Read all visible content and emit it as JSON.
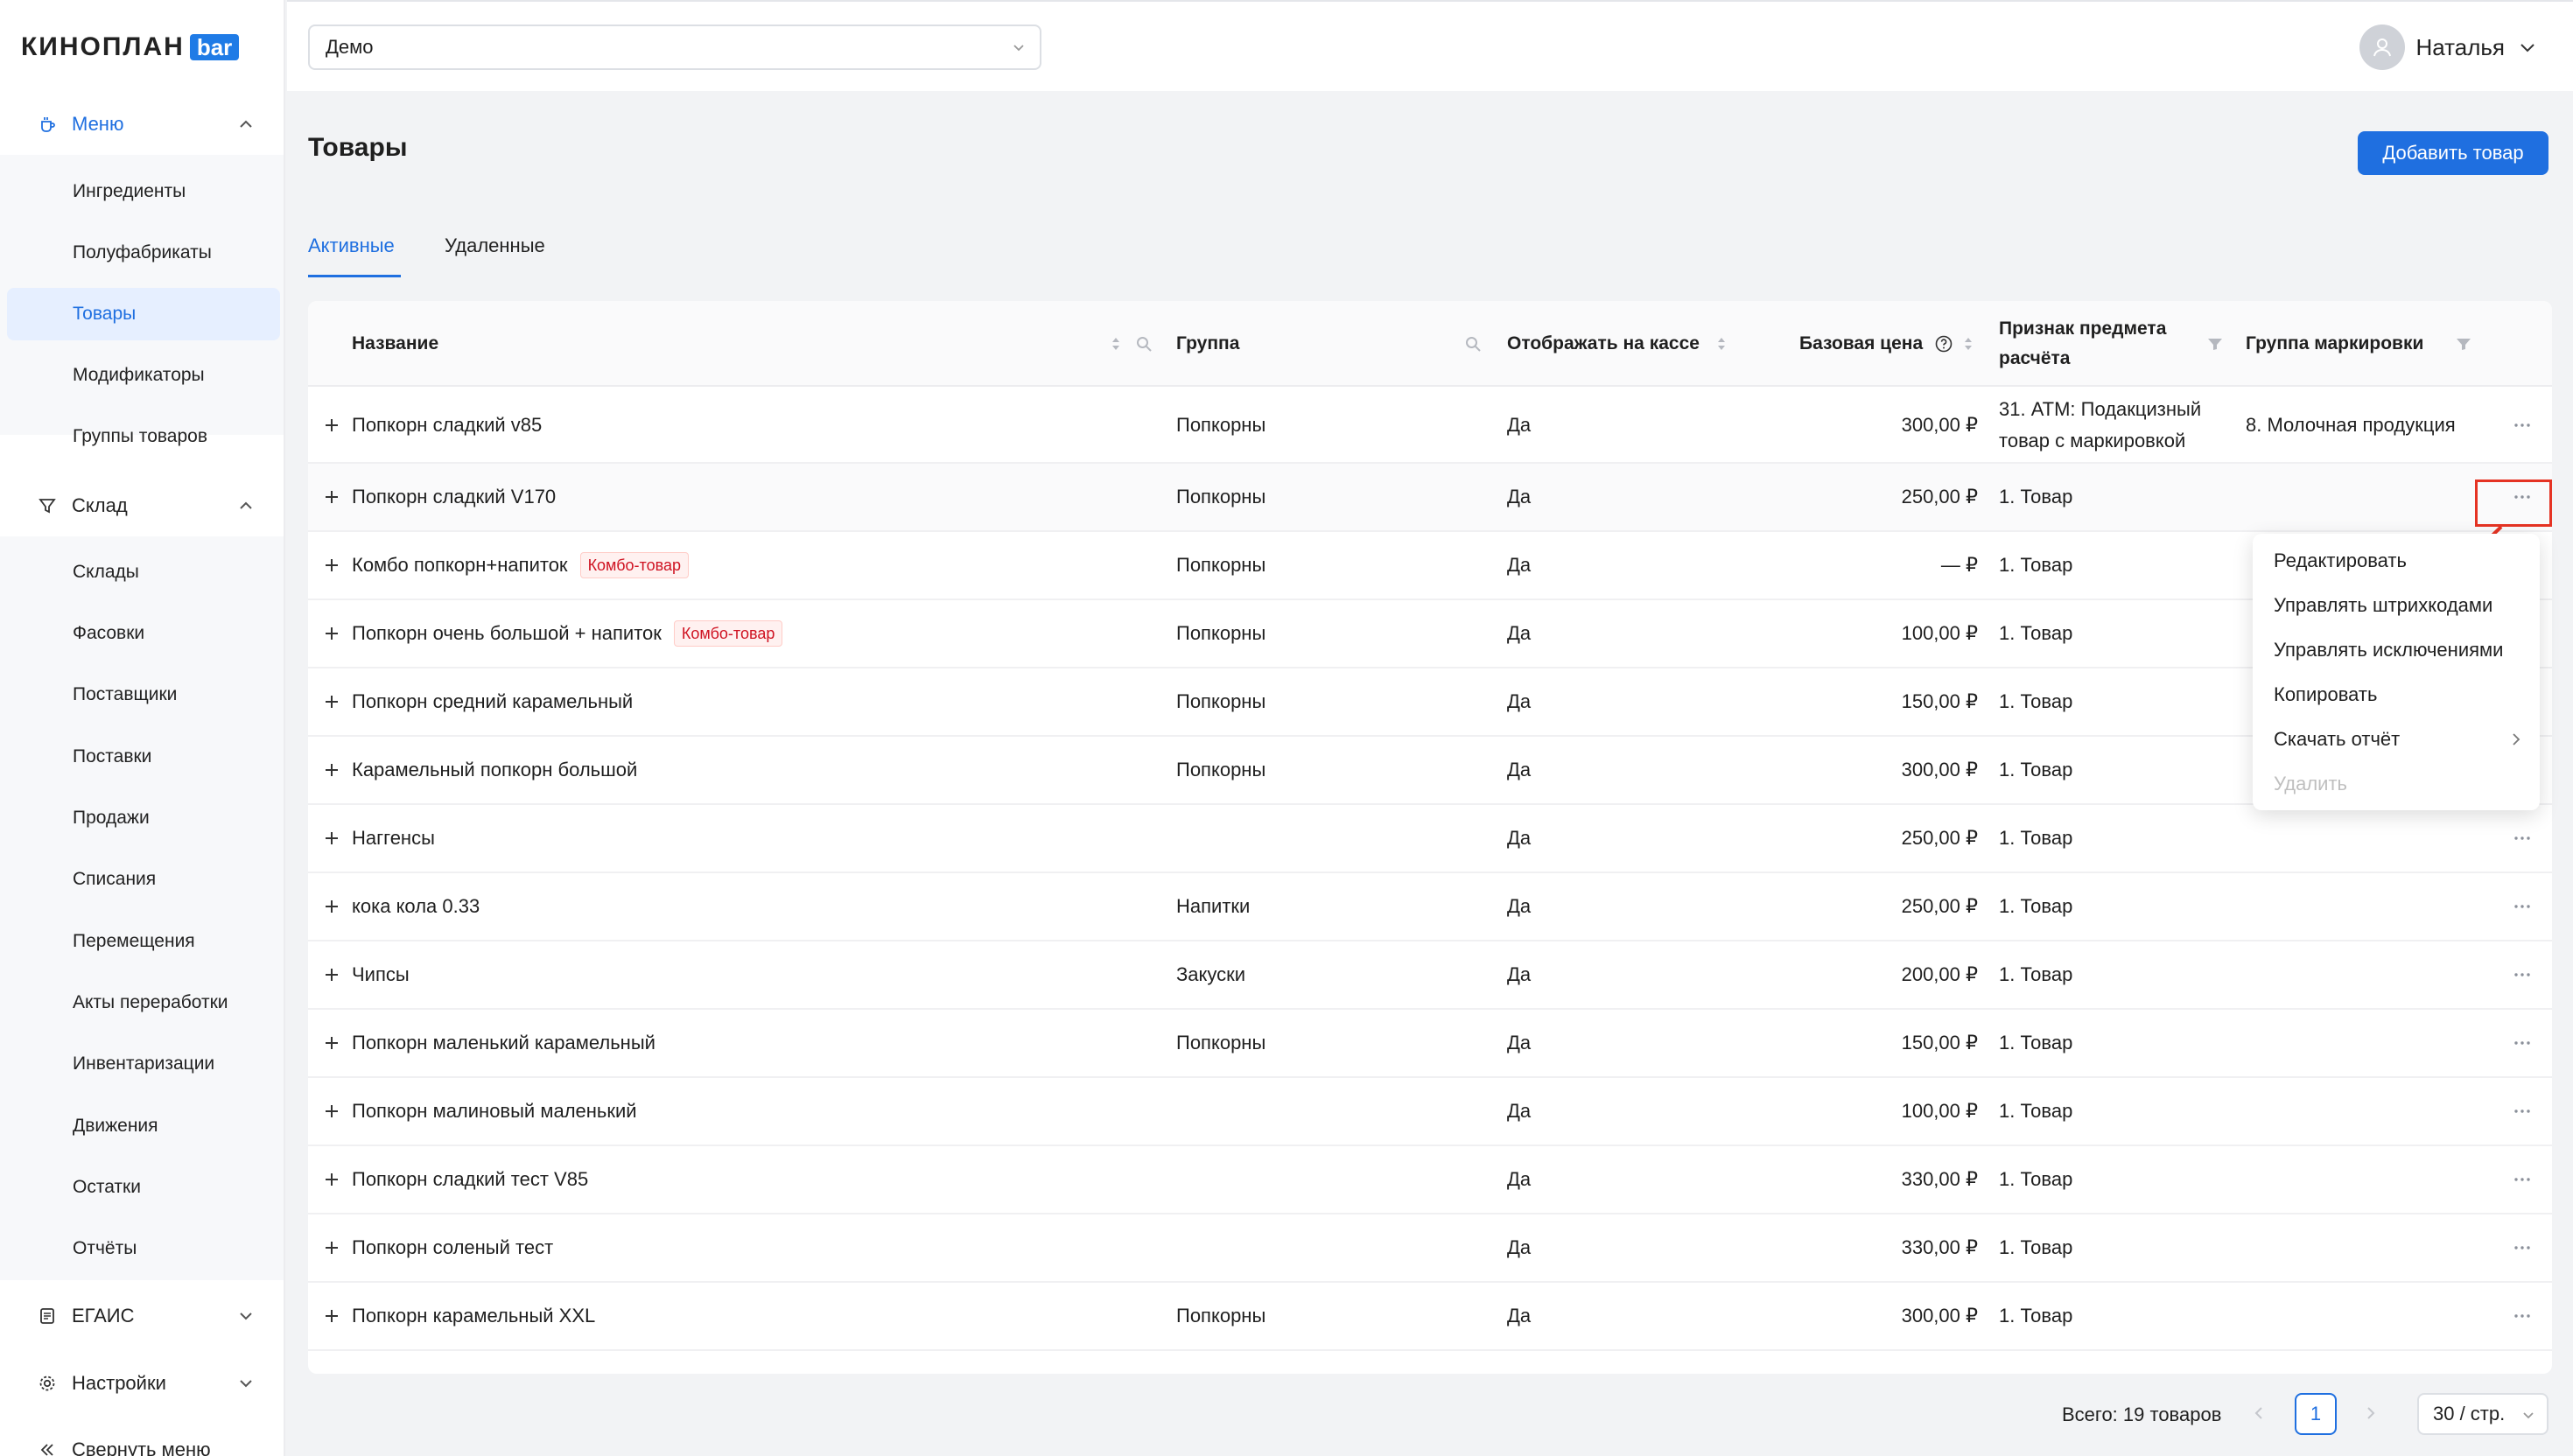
{
  "logo": {
    "text": "КИНОПЛАН",
    "badge": "bar"
  },
  "header": {
    "select_value": "Демо",
    "user_name": "Наталья"
  },
  "sidebar": {
    "groups": [
      {
        "label": "Меню",
        "icon": "coffee-cup-icon",
        "expanded": true,
        "items": [
          "Ингредиенты",
          "Полуфабрикаты",
          "Товары",
          "Модификаторы",
          "Группы товаров"
        ],
        "active_item": "Товары"
      },
      {
        "label": "Склад",
        "icon": "funnel-icon",
        "expanded": true,
        "items": [
          "Склады",
          "Фасовки",
          "Поставщики",
          "Поставки",
          "Продажи",
          "Списания",
          "Перемещения",
          "Акты переработки",
          "Инвентаризации",
          "Движения",
          "Остатки",
          "Отчёты"
        ]
      },
      {
        "label": "ЕГАИС",
        "icon": "document-icon",
        "expanded": false
      },
      {
        "label": "Настройки",
        "icon": "gear-icon",
        "expanded": false
      }
    ],
    "collapse_label": "Свернуть меню"
  },
  "page": {
    "title": "Товары",
    "add_button": "Добавить товар",
    "tabs": [
      "Активные",
      "Удаленные"
    ],
    "active_tab": "Активные"
  },
  "table": {
    "columns": [
      "Название",
      "Группа",
      "Отображать на кассе",
      "Базовая цена",
      "Признак предмета расчёта",
      "Группа маркировки"
    ],
    "rows": [
      {
        "name": "Попкорн сладкий v85",
        "group": "Попкорны",
        "display": "Да",
        "price": "300,00 ₽",
        "sign": "31. АТМ: Подакцизный товар с маркировкой",
        "mark_group": "8. Молочная продукция"
      },
      {
        "name": "Попкорн сладкий V170",
        "group": "Попкорны",
        "display": "Да",
        "price": "250,00 ₽",
        "sign": "1. Товар",
        "mark_group": ""
      },
      {
        "name": "Комбо попкорн+напиток",
        "tag": "Комбо-товар",
        "group": "Попкорны",
        "display": "Да",
        "price": "— ₽",
        "sign": "1. Товар",
        "mark_group": ""
      },
      {
        "name": "Попкорн очень большой + напиток",
        "tag": "Комбо-товар",
        "group": "Попкорны",
        "display": "Да",
        "price": "100,00 ₽",
        "sign": "1. Товар",
        "mark_group": ""
      },
      {
        "name": "Попкорн средний карамельный",
        "group": "Попкорны",
        "display": "Да",
        "price": "150,00 ₽",
        "sign": "1. Товар",
        "mark_group": ""
      },
      {
        "name": "Карамельный попкорн большой",
        "group": "Попкорны",
        "display": "Да",
        "price": "300,00 ₽",
        "sign": "1. Товар",
        "mark_group": ""
      },
      {
        "name": "Наггенсы",
        "group": "",
        "display": "Да",
        "price": "250,00 ₽",
        "sign": "1. Товар",
        "mark_group": ""
      },
      {
        "name": "кока кола 0.33",
        "group": "Напитки",
        "display": "Да",
        "price": "250,00 ₽",
        "sign": "1. Товар",
        "mark_group": ""
      },
      {
        "name": "Чипсы",
        "group": "Закуски",
        "display": "Да",
        "price": "200,00 ₽",
        "sign": "1. Товар",
        "mark_group": ""
      },
      {
        "name": "Попкорн маленький карамельный",
        "group": "Попкорны",
        "display": "Да",
        "price": "150,00 ₽",
        "sign": "1. Товар",
        "mark_group": ""
      },
      {
        "name": "Попкорн малиновый маленький",
        "group": "",
        "display": "Да",
        "price": "100,00 ₽",
        "sign": "1. Товар",
        "mark_group": ""
      },
      {
        "name": "Попкорн сладкий тест V85",
        "group": "",
        "display": "Да",
        "price": "330,00 ₽",
        "sign": "1. Товар",
        "mark_group": ""
      },
      {
        "name": "Попкорн соленый тест",
        "group": "",
        "display": "Да",
        "price": "330,00 ₽",
        "sign": "1. Товар",
        "mark_group": ""
      },
      {
        "name": "Попкорн карамельный XXL",
        "group": "Попкорны",
        "display": "Да",
        "price": "300,00 ₽",
        "sign": "1. Товар",
        "mark_group": ""
      }
    ]
  },
  "context_menu": {
    "items": [
      "Редактировать",
      "Управлять штрихкодами",
      "Управлять исключениями",
      "Копировать",
      "Скачать отчёт",
      "Удалить"
    ],
    "disabled": [
      "Удалить"
    ]
  },
  "pagination": {
    "total": "Всего: 19 товаров",
    "current": "1",
    "page_size": "30 / стр."
  },
  "colors": {
    "accent": "#1f6fe0",
    "annotation": "#e53323",
    "tag_text": "#cf1322"
  }
}
